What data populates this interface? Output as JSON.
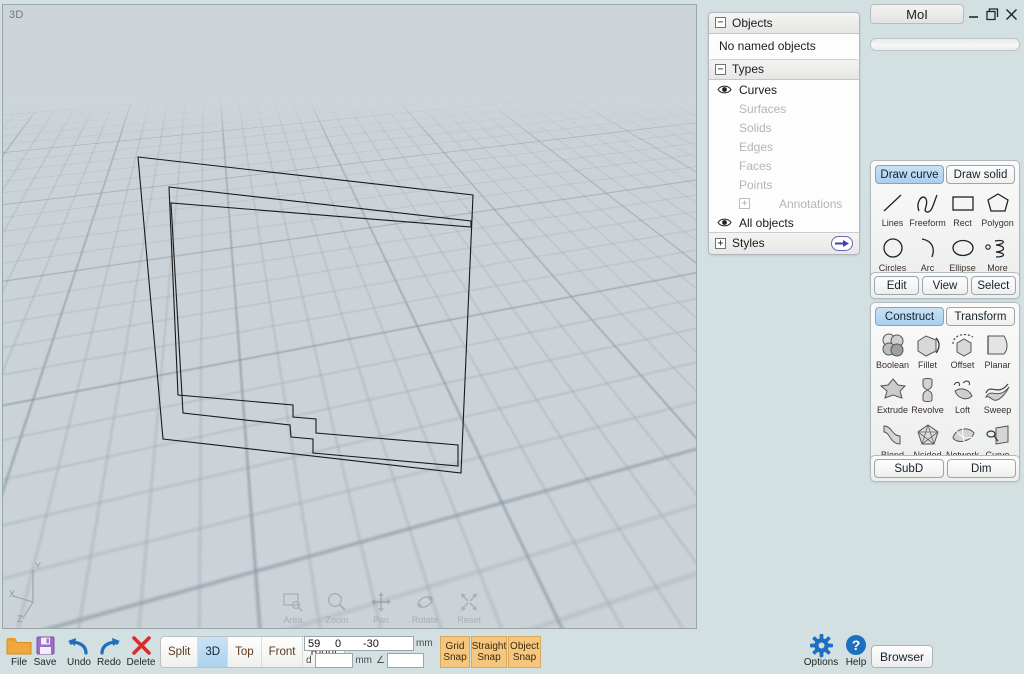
{
  "window": {
    "title": "MoI",
    "minimize": "minimize-icon",
    "restore": "restore-icon",
    "close": "close-icon"
  },
  "viewport": {
    "label": "3D",
    "axis": {
      "x": "X",
      "y": "Y",
      "z": "Z"
    },
    "nav": [
      {
        "name": "area",
        "label": "Area"
      },
      {
        "name": "zoom",
        "label": "Zoom"
      },
      {
        "name": "pan",
        "label": "Pan"
      },
      {
        "name": "rotate",
        "label": "Rotate"
      },
      {
        "name": "reset",
        "label": "Reset"
      }
    ]
  },
  "scene_panel": {
    "objects_header": "Objects",
    "objects_empty": "No named objects",
    "types_header": "Types",
    "types": [
      {
        "label": "Curves",
        "visible": true,
        "enabled": true
      },
      {
        "label": "Surfaces",
        "visible": false,
        "enabled": false
      },
      {
        "label": "Solids",
        "visible": false,
        "enabled": false
      },
      {
        "label": "Edges",
        "visible": false,
        "enabled": false
      },
      {
        "label": "Faces",
        "visible": false,
        "enabled": false
      },
      {
        "label": "Points",
        "visible": false,
        "enabled": false
      },
      {
        "label": "Annotations",
        "visible": false,
        "enabled": false,
        "expandable": true
      }
    ],
    "all_objects": "All objects",
    "styles_header": "Styles"
  },
  "sidebar": {
    "draw_tabs": [
      {
        "label": "Draw curve",
        "active": true
      },
      {
        "label": "Draw solid",
        "active": false
      }
    ],
    "draw_tools": [
      {
        "label": "Lines",
        "icon": "line-icon"
      },
      {
        "label": "Freeform",
        "icon": "freeform-curve-icon"
      },
      {
        "label": "Rect",
        "icon": "rectangle-icon"
      },
      {
        "label": "Polygon",
        "icon": "polygon-icon"
      },
      {
        "label": "Circles",
        "icon": "circle-icon"
      },
      {
        "label": "Arc",
        "icon": "arc-icon"
      },
      {
        "label": "Ellipse",
        "icon": "ellipse-icon"
      },
      {
        "label": "More",
        "icon": "more-curves-icon"
      }
    ],
    "edit_row": [
      {
        "label": "Edit"
      },
      {
        "label": "View"
      },
      {
        "label": "Select"
      }
    ],
    "construct_tabs": [
      {
        "label": "Construct",
        "active": true
      },
      {
        "label": "Transform",
        "active": false
      }
    ],
    "construct_tools": [
      {
        "label": "Boolean",
        "icon": "boolean-icon"
      },
      {
        "label": "Fillet",
        "icon": "fillet-icon"
      },
      {
        "label": "Offset",
        "icon": "offset-icon"
      },
      {
        "label": "Planar",
        "icon": "planar-icon"
      },
      {
        "label": "Extrude",
        "icon": "extrude-icon"
      },
      {
        "label": "Revolve",
        "icon": "revolve-icon"
      },
      {
        "label": "Loft",
        "icon": "loft-icon"
      },
      {
        "label": "Sweep",
        "icon": "sweep-icon"
      },
      {
        "label": "Blend",
        "icon": "blend-icon"
      },
      {
        "label": "Nsided",
        "icon": "nsided-icon"
      },
      {
        "label": "Network",
        "icon": "network-icon"
      },
      {
        "label": "Curve",
        "icon": "curve-tools-icon"
      }
    ],
    "bottom_row": [
      {
        "label": "SubD"
      },
      {
        "label": "Dim"
      }
    ]
  },
  "bottom_bar": {
    "file_tools": [
      {
        "label": "File",
        "icon": "folder-icon"
      },
      {
        "label": "Save",
        "icon": "floppy-disk-icon"
      },
      {
        "label": "Undo",
        "icon": "undo-arrow-icon"
      },
      {
        "label": "Redo",
        "icon": "redo-arrow-icon"
      },
      {
        "label": "Delete",
        "icon": "x-delete-icon"
      }
    ],
    "view_buttons": [
      {
        "label": "Split",
        "active": false
      },
      {
        "label": "3D",
        "active": true
      },
      {
        "label": "Top",
        "active": false
      },
      {
        "label": "Front",
        "active": false
      },
      {
        "label": "Right",
        "active": false
      }
    ],
    "coords": {
      "x": "59",
      "y": "0",
      "z": "-30",
      "unit": "mm",
      "distance_label": "d",
      "distance_value": "",
      "distance_unit": "mm",
      "angle_symbol": "∠",
      "angle_value": ""
    },
    "snaps": [
      {
        "line1": "Grid",
        "line2": "Snap",
        "active": true
      },
      {
        "line1": "Straight",
        "line2": "Snap",
        "active": true
      },
      {
        "line1": "Object",
        "line2": "Snap",
        "active": true
      }
    ],
    "options": {
      "label": "Options",
      "icon": "gear-icon"
    },
    "help": {
      "label": "Help",
      "icon": "question-circle-icon"
    },
    "browser": "Browser"
  },
  "colors": {
    "app_background": "#d3e0e2",
    "viewport_background": "#cbd3d8",
    "accent_blue": "#a8cfee",
    "snap_orange": "#f5c77e",
    "curve_stroke": "#1a1a1a",
    "panel_white": "#fbfbfb"
  }
}
